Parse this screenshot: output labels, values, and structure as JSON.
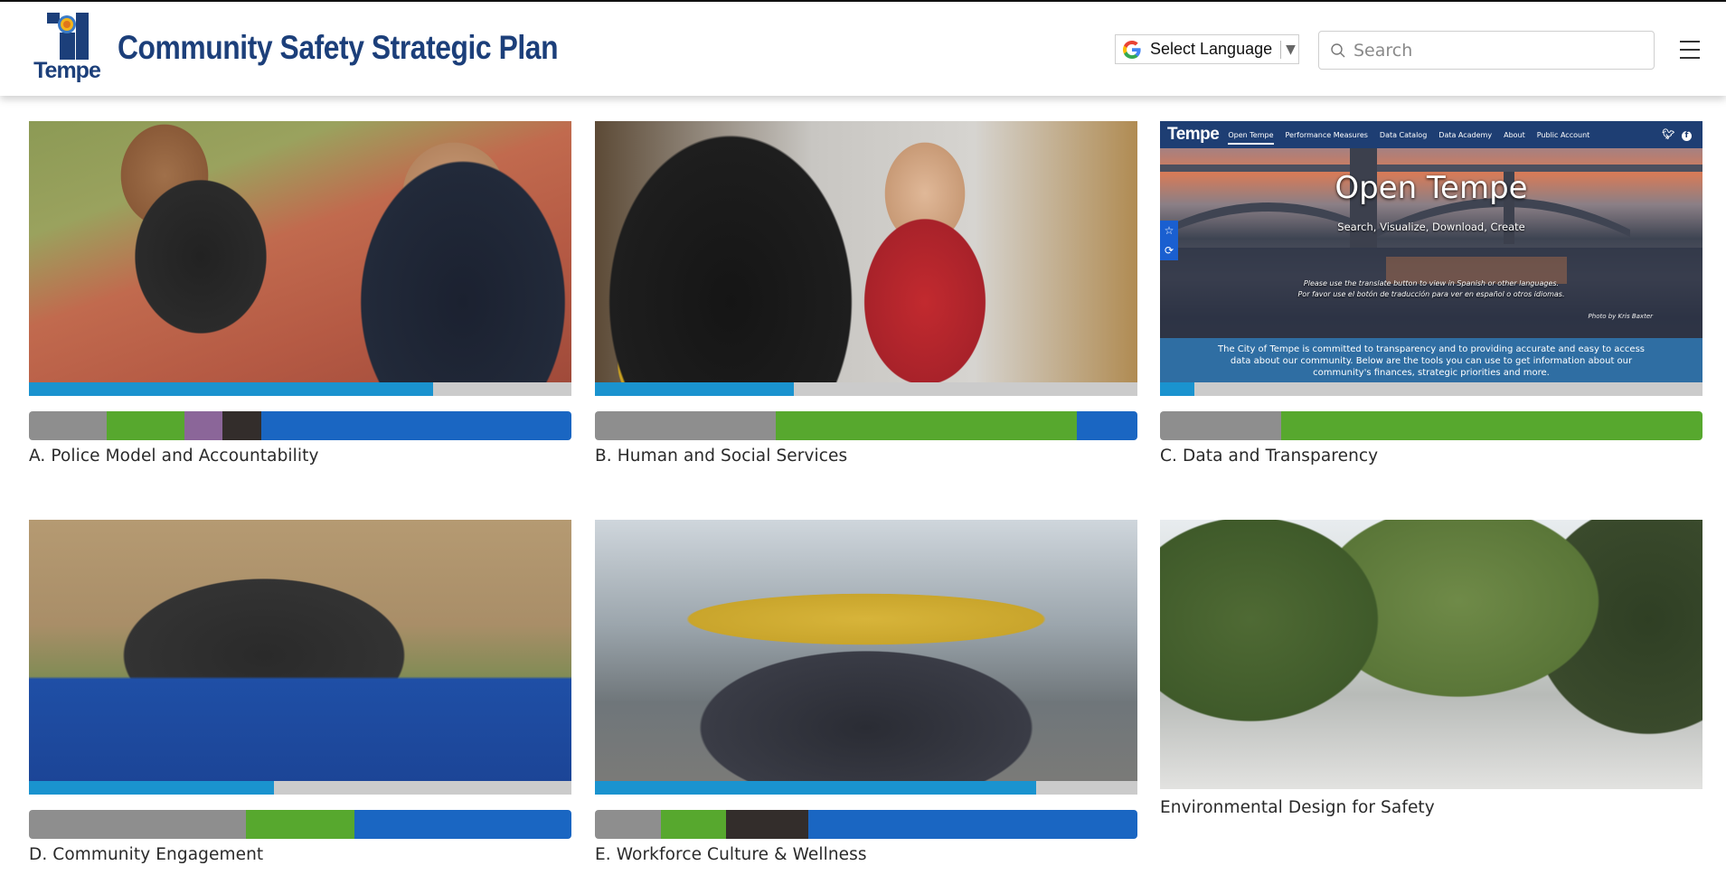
{
  "header": {
    "logo_word": "Tempe",
    "site_title": "Community Safety Strategic Plan",
    "language_selector": {
      "label": "Select Language",
      "caret": "▼",
      "icon": "google-g-icon"
    },
    "search": {
      "placeholder": "Search",
      "value": "",
      "icon": "search-icon"
    },
    "menu_icon": "hamburger-menu-icon"
  },
  "colors": {
    "brand_navy": "#1c3f7a",
    "progress_fill": "#1a93cf",
    "progress_track": "#cbcbcb",
    "segment_gray": "#8e8e8e",
    "segment_green": "#57a82e",
    "segment_purple": "#8b6699",
    "segment_dark": "#332d2b",
    "segment_blue": "#1a66c2"
  },
  "cards": [
    {
      "label": "A. Police Model and Accountability",
      "photo": "officer and child at community event",
      "progress_percent": 74.5,
      "segments": [
        {
          "status": "gray",
          "share": 14.3
        },
        {
          "status": "green",
          "share": 14.3
        },
        {
          "status": "purple",
          "share": 7.1
        },
        {
          "status": "dark",
          "share": 7.1
        },
        {
          "status": "blue",
          "share": 57.2
        }
      ]
    },
    {
      "label": "B. Human and Social Services",
      "photo": "social worker reviewing paperwork",
      "progress_percent": 36.7,
      "segments": [
        {
          "status": "gray",
          "share": 33.3
        },
        {
          "status": "green",
          "share": 55.6
        },
        {
          "status": "blue",
          "share": 11.1
        }
      ]
    },
    {
      "label": "C. Data and Transparency",
      "photo": "Open Tempe website screenshot",
      "progress_percent": 6.4,
      "segments": [
        {
          "status": "gray",
          "share": 22.3
        },
        {
          "status": "green",
          "share": 77.7
        }
      ],
      "open_tempe": {
        "logo": "Tempe",
        "nav": [
          "Open Tempe",
          "Performance Measures",
          "Data Catalog",
          "Data Academy",
          "About",
          "Public Account"
        ],
        "active_nav": "Open Tempe",
        "social": [
          "twitter-icon",
          "facebook-icon"
        ],
        "title": "Open Tempe",
        "subtitle": "Search, Visualize, Download, Create",
        "note_en": "Please use the translate button to view in Spanish or other languages.",
        "note_es": "Por favor use el botón de traducción para ver en español o otros idiomas.",
        "credit": "Photo by Kris Baxter",
        "band_text": "The City of Tempe is committed to transparency and to providing accurate and easy to access data about our community. Below are the tools you can use to get information about our community's finances, strategic priorities and more."
      }
    },
    {
      "label": "D. Community Engagement",
      "photo": "officers and mascot at outreach table",
      "progress_percent": 45.1,
      "segments": [
        {
          "status": "gray",
          "share": 40
        },
        {
          "status": "green",
          "share": 20
        },
        {
          "status": "blue",
          "share": 40
        }
      ]
    },
    {
      "label": "E. Workforce Culture & Wellness",
      "photo": "parade with TEMPE balloons",
      "progress_percent": 81.3,
      "segments": [
        {
          "status": "gray",
          "share": 12.1
        },
        {
          "status": "green",
          "share": 12.1
        },
        {
          "status": "dark",
          "share": 15.2
        },
        {
          "status": "blue",
          "share": 60.6
        }
      ]
    },
    {
      "label": "Environmental Design for Safety",
      "photo": "tree-lined downtown street"
    }
  ]
}
